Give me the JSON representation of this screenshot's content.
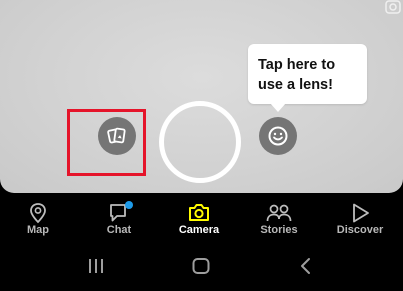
{
  "tooltip": {
    "line1": "Tap here to",
    "line2": "use a lens!"
  },
  "camera": {
    "memories_icon": "memories-cards-icon",
    "lens_icon": "smiley-lens-icon",
    "shutter_icon": "shutter-ring",
    "highlight_color": "#e5142a"
  },
  "nav": {
    "items": [
      {
        "label": "Map",
        "icon": "map-pin-icon",
        "active": false
      },
      {
        "label": "Chat",
        "icon": "chat-bubble-icon",
        "active": false,
        "badge_color": "#1e9be9"
      },
      {
        "label": "Camera",
        "icon": "camera-icon",
        "active": true,
        "accent": "#fffc00"
      },
      {
        "label": "Stories",
        "icon": "stories-people-icon",
        "active": false
      },
      {
        "label": "Discover",
        "icon": "discover-play-icon",
        "active": false
      }
    ]
  },
  "system_nav": {
    "buttons": [
      "recents-icon",
      "home-icon",
      "back-icon"
    ]
  }
}
